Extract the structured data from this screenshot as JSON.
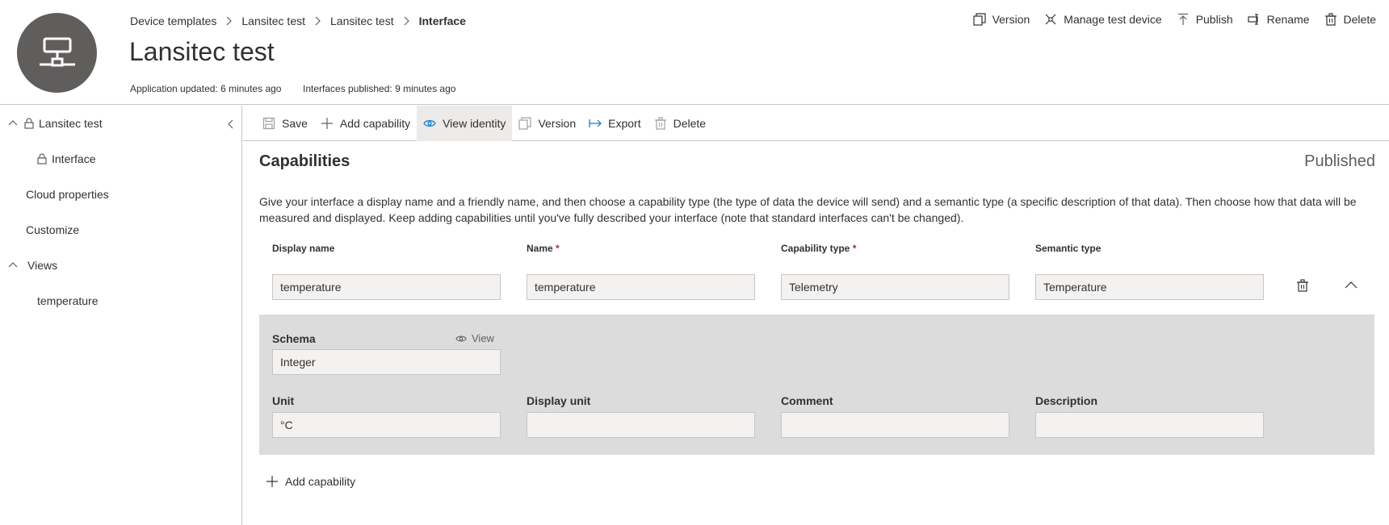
{
  "header": {
    "breadcrumb": [
      "Device templates",
      "Lansitec test",
      "Lansitec test",
      "Interface"
    ],
    "title": "Lansitec test",
    "app_updated": "Application updated: 6 minutes ago",
    "interfaces_published": "Interfaces published: 9 minutes ago",
    "actions": {
      "version": "Version",
      "manage_test_device": "Manage test device",
      "publish": "Publish",
      "rename": "Rename",
      "delete": "Delete"
    },
    "avatar_icon": "network-device-icon",
    "avatar_color": "#605e5c"
  },
  "sidebar": {
    "items": [
      {
        "label": "Lansitec test"
      },
      {
        "label": "Interface"
      },
      {
        "label": "Cloud properties"
      },
      {
        "label": "Customize"
      },
      {
        "label": "Views"
      },
      {
        "label": "temperature"
      }
    ]
  },
  "toolbar": {
    "save": "Save",
    "add_capability": "Add capability",
    "view_identity": "View identity",
    "version": "Version",
    "export": "Export",
    "delete": "Delete"
  },
  "main": {
    "section_title": "Capabilities",
    "status": "Published",
    "intro": "Give your interface a display name and a friendly name, and then choose a capability type (the type of data the device will send) and a semantic type (a specific description of that data). Then choose how that data will be measured and displayed. Keep adding capabilities until you've fully described your interface (note that standard interfaces can't be changed).",
    "columns": {
      "display_name": "Display name",
      "name": "Name",
      "capability_type": "Capability type",
      "semantic_type": "Semantic type",
      "required_marker": "*"
    },
    "capability": {
      "display_name": "temperature",
      "name": "temperature",
      "capability_type": "Telemetry",
      "semantic_type": "Temperature",
      "schema_label": "Schema",
      "schema_view": "View",
      "schema": "Integer",
      "unit_label": "Unit",
      "unit": "°C",
      "display_unit_label": "Display unit",
      "display_unit": "",
      "comment_label": "Comment",
      "comment": "",
      "description_label": "Description",
      "description": ""
    },
    "add_capability": "Add capability"
  }
}
